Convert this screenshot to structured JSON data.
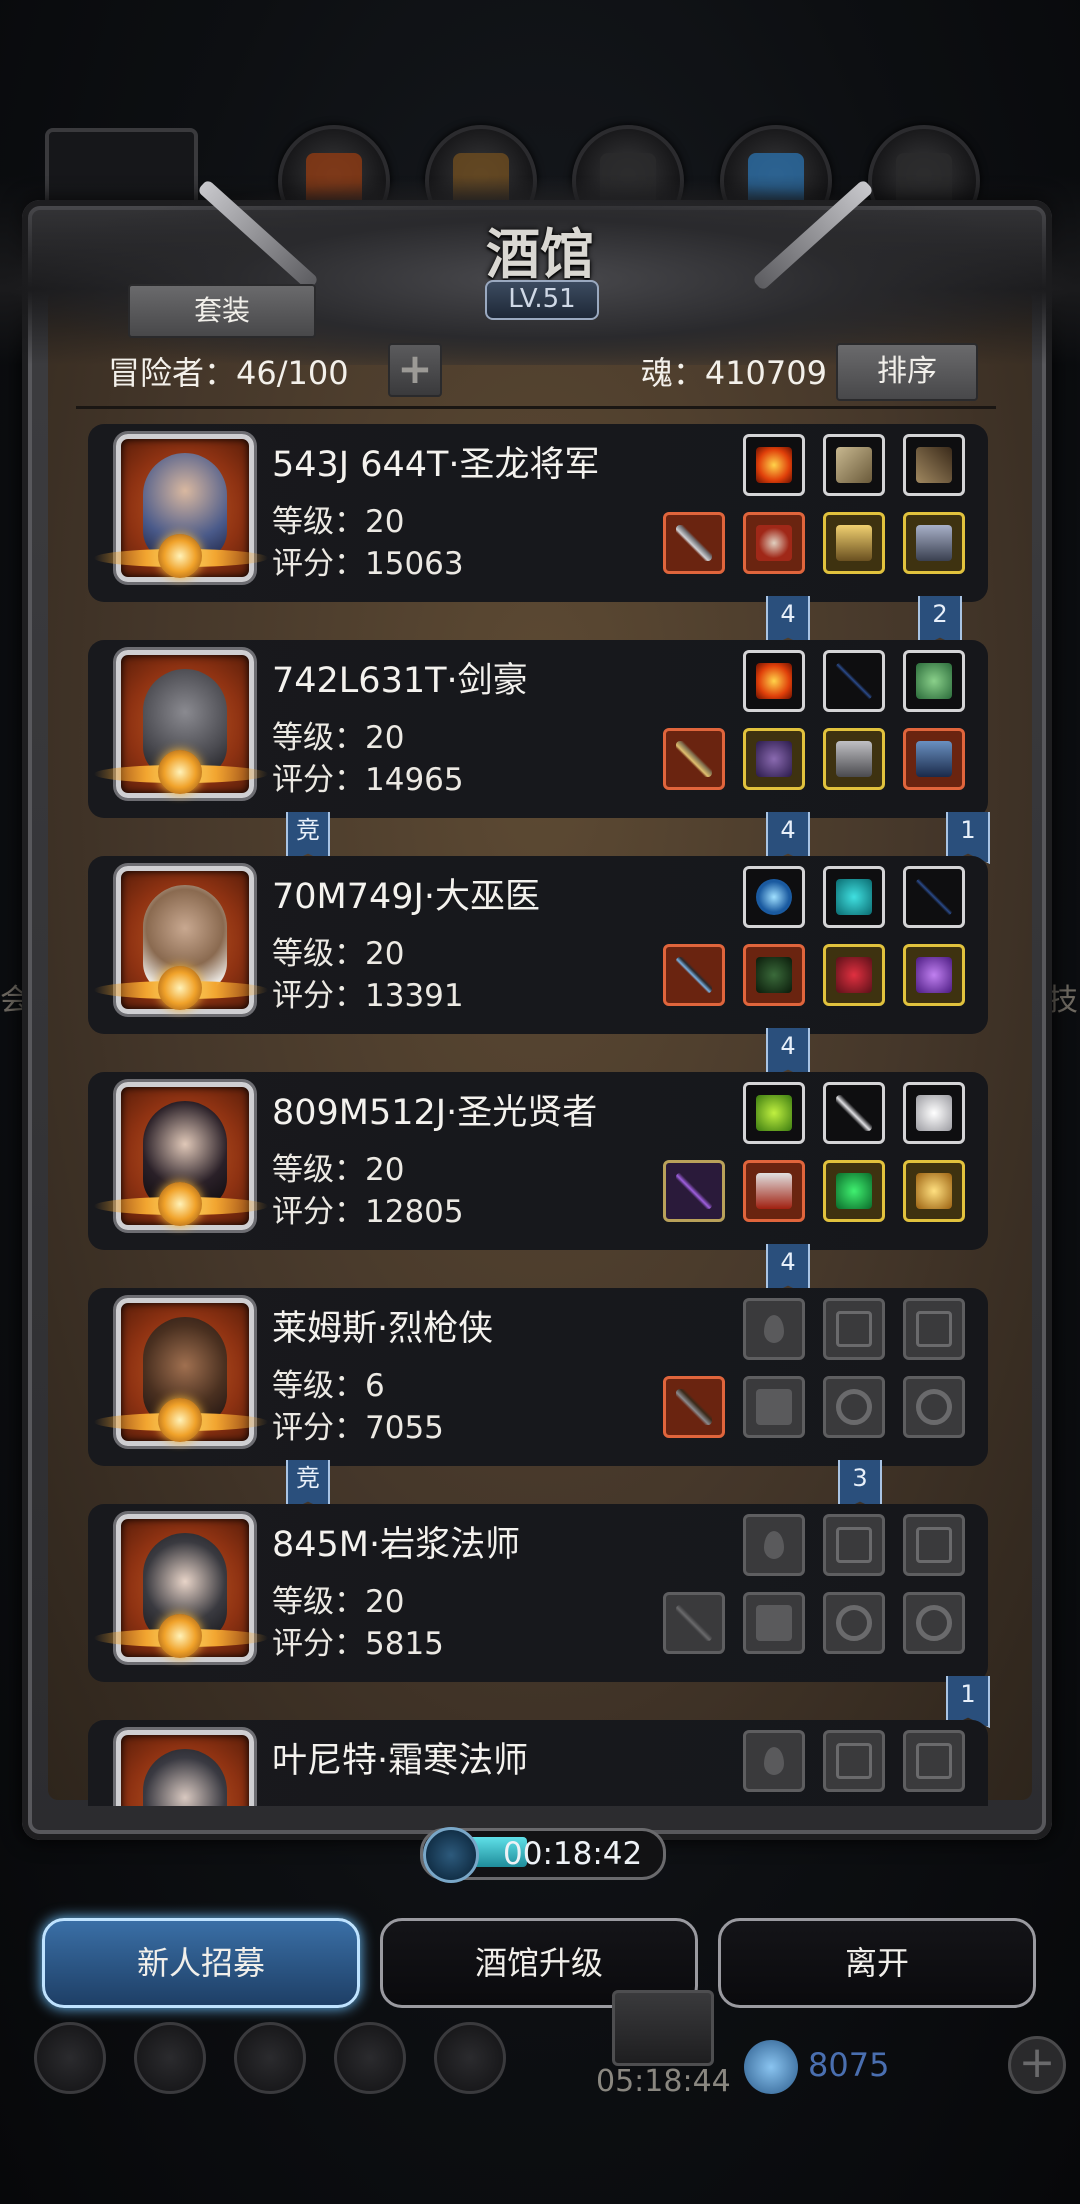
{
  "header": {
    "title": "酒馆",
    "level": "LV.51",
    "suit_button": "套装",
    "adventurers_label": "冒险者：46/100",
    "plus_label": "+",
    "soul_label": "魂：410709",
    "sort_button": "排序"
  },
  "heroes": [
    {
      "name": "543J 644T·圣龙将军",
      "level": "等级：20",
      "score": "评分：15063",
      "slots_top": [
        "fire-orb",
        "bone-relic",
        "claw-relic"
      ],
      "slots_bottom": [
        "greatsword",
        "red-armor",
        "gold-shield",
        "gold-cross-shield"
      ]
    },
    {
      "name": "742L631T·剑豪",
      "level": "等级：20",
      "score": "评分：14965",
      "slots_top": [
        "fire-orb",
        "dark-blade",
        "jade-ring"
      ],
      "slots_bottom": [
        "katana",
        "purple-armor",
        "silver-bracer",
        "blue-gauntlet"
      ]
    },
    {
      "name": "70M749J·大巫医",
      "level": "等级：20",
      "score": "评分：13391",
      "slots_top": [
        "blue-orb",
        "turquoise-stone",
        "dark-blade"
      ],
      "slots_bottom": [
        "staff",
        "green-armor",
        "ruby-amulet",
        "purple-ring"
      ]
    },
    {
      "name": "809M512J·圣光贤者",
      "level": "等级：20",
      "score": "评分：12805",
      "slots_top": [
        "green-crystal",
        "silver-feather",
        "white-wing"
      ],
      "slots_bottom": [
        "purple-wand",
        "red-robe",
        "emerald-charm",
        "gold-ring"
      ]
    },
    {
      "name": "莱姆斯·烈枪侠",
      "level": "等级：6",
      "score": "评分：7055",
      "slots_top": [
        "empty-drop",
        "empty-hourglass",
        "empty-hourglass"
      ],
      "slots_bottom": [
        "rifle",
        "empty-armor",
        "empty-ring",
        "empty-ring"
      ]
    },
    {
      "name": "845M·岩浆法师",
      "level": "等级：20",
      "score": "评分：5815",
      "slots_top": [
        "empty-drop",
        "empty-hourglass",
        "empty-hourglass"
      ],
      "slots_bottom": [
        "empty-staff",
        "empty-armor",
        "empty-ring",
        "empty-ring"
      ]
    },
    {
      "name": "叶尼特·霜寒法师",
      "level": "",
      "score": "",
      "slots_top": [
        "empty-drop",
        "empty-hourglass",
        "empty-hourglass"
      ],
      "slots_bottom": []
    }
  ],
  "ribbons": [
    "4",
    "2",
    "竞",
    "4",
    "1",
    "4",
    "4",
    "竞",
    "3",
    "1"
  ],
  "timer": {
    "text": "00:18:42"
  },
  "buttons": {
    "recruit": "新人招募",
    "upgrade": "酒馆升级",
    "leave": "离开"
  },
  "hud": {
    "time": "05:18:44",
    "count": "8075",
    "plus": "+"
  },
  "side_text": {
    "left": "会",
    "right": "技"
  },
  "colors": {
    "accent": "#2a4f7c",
    "parchment": "#45372a",
    "card": "#18191d",
    "score_gold": "#e1c23d"
  }
}
